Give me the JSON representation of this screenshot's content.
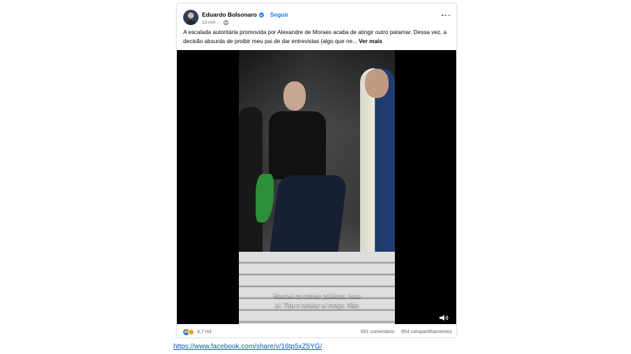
{
  "post": {
    "author": "Eduardo Bolsonaro",
    "follow_label": "Seguir",
    "time": "13 min",
    "caption_text": "A escalada autoritária promovida por Alexandre de Moraes acaba de atingir outro patamar. Dessa vez, a decisão absurda de proibir meu pai de dar entrevistas (algo que ne...",
    "see_more_label": "Ver mais",
    "video": {
      "subtitle_line1": "Roubei os cofres públicos. Isso",
      "subtitle_line2": "aí. Tira o celular aí moço. Não"
    },
    "reactions_count": "4,7 mil",
    "comments": "691 comentário",
    "shares": "654 compartilhamentos"
  },
  "source_link": "https://www.facebook.com/share/v/16tp5xZ5YG/",
  "colors": {
    "accent": "#1877f2",
    "muted_text": "#65676b",
    "link": "#0b57d0"
  },
  "icons": [
    "verified-badge-icon",
    "globe-icon",
    "more-options-icon",
    "like-reaction-icon",
    "love-reaction-icon",
    "volume-icon"
  ]
}
